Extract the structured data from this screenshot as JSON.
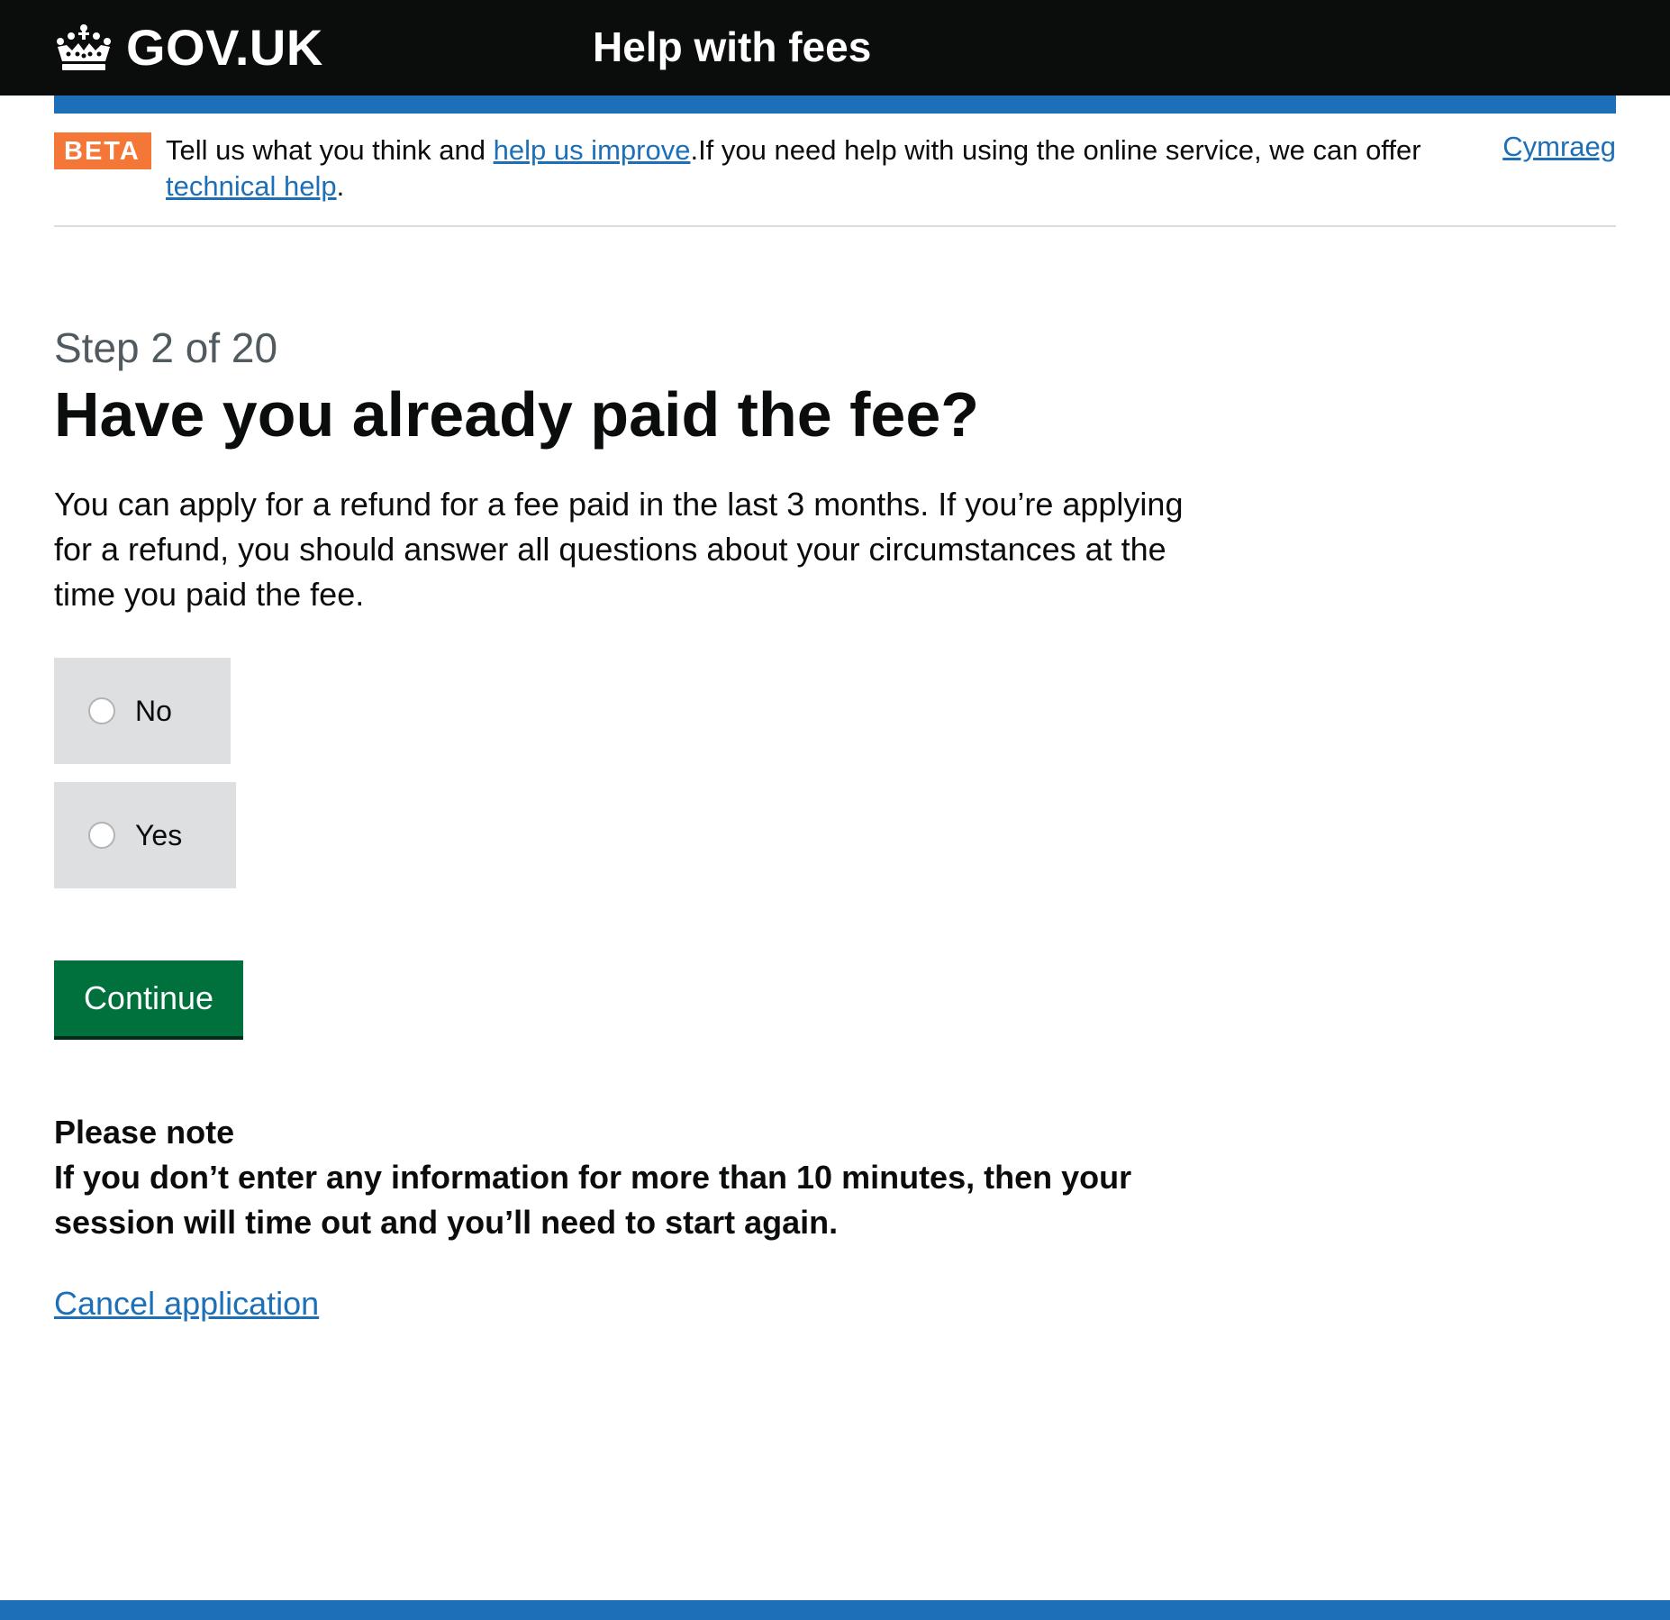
{
  "header": {
    "logo_text": "GOV.UK",
    "service_name": "Help with fees",
    "colors": {
      "background": "#0b0c0c",
      "accent_bar": "#1d70b8"
    },
    "logo_icon": "crown-icon"
  },
  "phase_banner": {
    "tag": "BETA",
    "text_before": "Tell us what you think and ",
    "feedback_link": "help us improve",
    "text_middle": ".If you need help with using the online service, we can offer ",
    "help_link": "technical help",
    "text_after": ".",
    "language_link": "Cymraeg",
    "tag_color": "#f47738"
  },
  "main": {
    "caption": "Step 2 of 20",
    "heading": "Have you already paid the fee?",
    "intro": "You can apply for a refund for a fee paid in the last 3 months. If you’re applying for a refund, you should answer all questions about your circumstances at the time you paid the fee.",
    "options": [
      {
        "label": "No",
        "selected": false
      },
      {
        "label": "Yes",
        "selected": false
      }
    ],
    "continue_label": "Continue",
    "continue_color": "#00703c",
    "note_title": "Please note",
    "note_text": "If you don’t enter any information for more than 10 minutes, then your session will time out and you’ll need to start again.",
    "cancel_link": "Cancel application"
  }
}
